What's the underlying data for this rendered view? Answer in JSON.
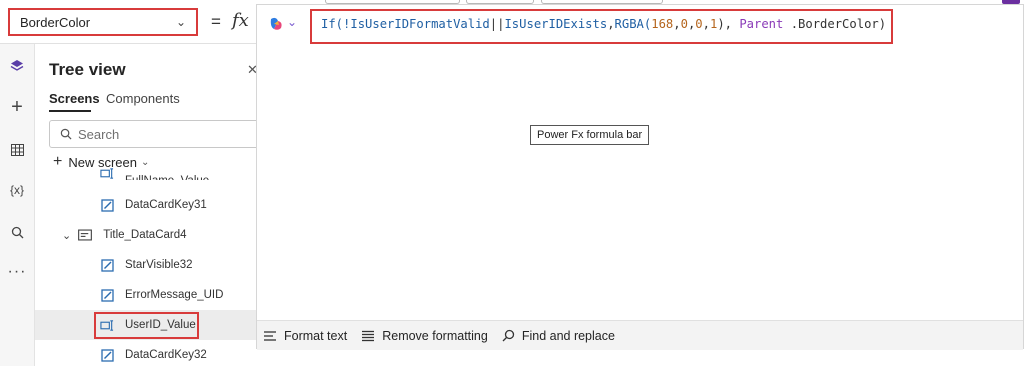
{
  "property_dropdown": {
    "value": "BorderColor"
  },
  "formula_bar": {
    "equals": "=",
    "fx": "fx",
    "tokens": [
      {
        "text": "If(!",
        "kind": "kw"
      },
      {
        "text": "IsUserIDFormatValid",
        "kind": "kw"
      },
      {
        "text": "||",
        "kind": "plain"
      },
      {
        "text": "IsUserIDExists",
        "kind": "kw"
      },
      {
        "text": ",",
        "kind": "plain"
      },
      {
        "text": "RGBA(",
        "kind": "kw"
      },
      {
        "text": "168",
        "kind": "num"
      },
      {
        "text": ",",
        "kind": "plain"
      },
      {
        "text": "0",
        "kind": "num"
      },
      {
        "text": ",",
        "kind": "plain"
      },
      {
        "text": "0",
        "kind": "num"
      },
      {
        "text": ",",
        "kind": "plain"
      },
      {
        "text": "1",
        "kind": "num"
      },
      {
        "text": "), ",
        "kind": "plain"
      },
      {
        "text": "Parent",
        "kind": "par"
      },
      {
        "text": " .BorderColor)",
        "kind": "plain"
      }
    ],
    "tooltip": "Power Fx formula bar",
    "format_actions": [
      "Format text",
      "Remove formatting",
      "Find and replace"
    ]
  },
  "tree_view": {
    "title": "Tree view",
    "tabs": [
      "Screens",
      "Components"
    ],
    "search_placeholder": "Search",
    "new_screen": "New screen",
    "rows": [
      {
        "label": "FullName_Value",
        "icon": "input-icon",
        "indent": 2,
        "partial": true
      },
      {
        "label": "DataCardKey31",
        "icon": "edit-icon",
        "indent": 2
      },
      {
        "label": "Title_DataCard4",
        "icon": "card-icon",
        "indent": 1,
        "expand": true
      },
      {
        "label": "StarVisible32",
        "icon": "edit-icon",
        "indent": 2
      },
      {
        "label": "ErrorMessage_UID",
        "icon": "edit-icon",
        "indent": 2
      },
      {
        "label": "UserID_Value",
        "icon": "input-icon",
        "indent": 2,
        "selected": true
      },
      {
        "label": "DataCardKey32",
        "icon": "edit-icon",
        "indent": 2
      }
    ]
  },
  "left_rail": [
    "layers-icon",
    "add-icon",
    "table-icon",
    "variables-icon",
    "search-icon",
    "more-icon"
  ],
  "colors": {
    "highlight": "#d83b3b",
    "keyword": "#1f5fa3",
    "number": "#b5651d",
    "parent": "#8a3bb8"
  }
}
